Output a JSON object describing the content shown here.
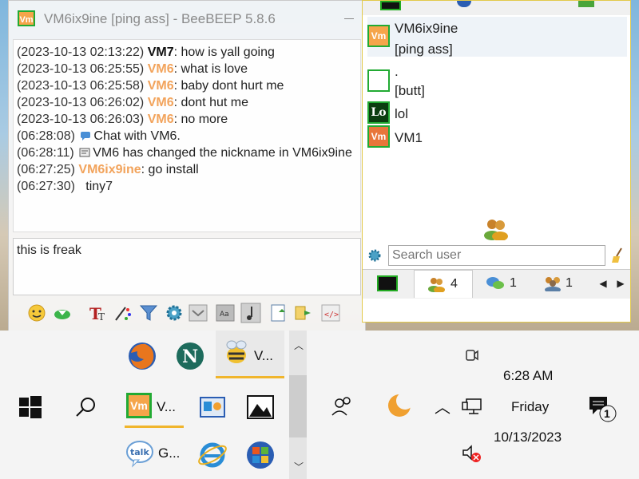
{
  "chat": {
    "title": "VM6ix9ine [ping ass] - BeeBEEP 5.8.6",
    "app_icon_text": "Vm",
    "messages": [
      {
        "time": "(2023-10-13 02:13:22)",
        "nick": "VM7",
        "text": ": how is yall going",
        "nick_color": "#111111"
      },
      {
        "time": "(2023-10-13 06:25:55)",
        "nick": "VM6",
        "text": ": what is love",
        "nick_color": "#f2a35b"
      },
      {
        "time": "(2023-10-13 06:25:58)",
        "nick": "VM6",
        "text": ": baby dont hurt me",
        "nick_color": "#f2a35b"
      },
      {
        "time": "(2023-10-13 06:26:02)",
        "nick": "VM6",
        "text": ": dont hut me",
        "nick_color": "#f2a35b"
      },
      {
        "time": "(2023-10-13 06:26:03)",
        "nick": "VM6",
        "text": ": no more",
        "nick_color": "#f2a35b"
      }
    ],
    "system_messages": [
      {
        "time": "(06:28:08)",
        "text": "Chat with VM6."
      },
      {
        "time": "(06:28:11)",
        "text": "VM6 has changed the nickname in VM6ix9ine"
      }
    ],
    "last_messages": [
      {
        "time": "(06:27:25)",
        "nick": "VM6ix9ine",
        "text": ": go install"
      },
      {
        "time": "(06:27:30)",
        "text": "tiny7"
      }
    ],
    "input_value": "this is freak"
  },
  "users": {
    "list": [
      {
        "avatar": "Vm",
        "name": "VM6ix9ine",
        "status": "[ping ass]",
        "avatar_bg": "#f5a54a",
        "avatar_border": "#22aa33"
      },
      {
        "avatar": "",
        "name": ".",
        "status": "[butt]",
        "avatar_bg": "#ffffff",
        "avatar_border": "#22aa33"
      },
      {
        "avatar": "Lo",
        "name": "lol",
        "status": "",
        "avatar_bg": "#0b3d10",
        "avatar_border": "#22aa33"
      },
      {
        "avatar": "Vm",
        "name": "VM1",
        "status": "",
        "avatar_bg": "#e8763a",
        "avatar_border": "#22aa33"
      }
    ],
    "search_placeholder": "Search user",
    "tabs": [
      {
        "icon": "user-list-icon",
        "count": "4"
      },
      {
        "icon": "chat-icon",
        "count": "1"
      },
      {
        "icon": "group-icon",
        "count": "1"
      }
    ]
  },
  "taskbar": {
    "apps_row1_label": "V...",
    "beebeep_label": "V...",
    "talk_label": "G...",
    "time": "6:28 AM",
    "day": "Friday",
    "date": "10/13/2023",
    "notification_count": "1"
  },
  "colors": {
    "accent": "#f0b52c",
    "nick_vm6": "#f2a35b"
  }
}
